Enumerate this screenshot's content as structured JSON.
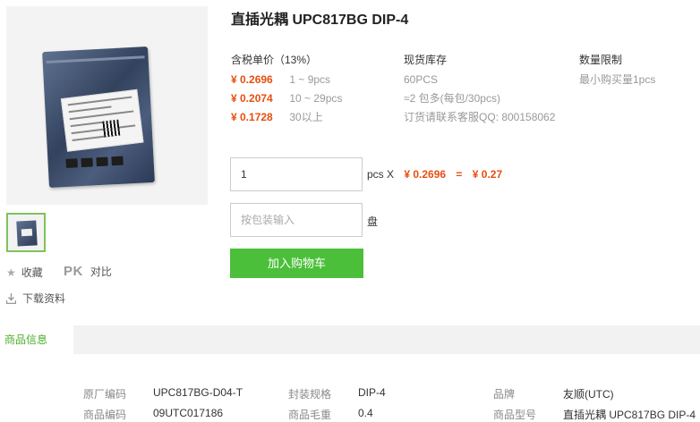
{
  "product": {
    "title": "直插光耦 UPC817BG DIP-4"
  },
  "pricing": {
    "header": "含税单价（13%）",
    "rows": [
      {
        "price": "¥ 0.2696",
        "range": "1 ~ 9pcs"
      },
      {
        "price": "¥ 0.2074",
        "range": "10 ~ 29pcs"
      },
      {
        "price": "¥ 0.1728",
        "range": "30以上"
      }
    ]
  },
  "stock": {
    "header": "现货库存",
    "qty": "60PCS",
    "pack": "≈2 包多(每包/30pcs)",
    "contact": "订货请联系客服QQ: 800158062"
  },
  "limit": {
    "header": "数量限制",
    "min": "最小购买量1pcs"
  },
  "order": {
    "qty_value": "1",
    "qty_unit": "pcs X",
    "unit_price": "¥ 0.2696",
    "equals": "=",
    "total": "¥ 0.27",
    "pack_placeholder": "按包装输入",
    "pack_unit": "盘",
    "cart_button": "加入购物车"
  },
  "actions": {
    "favorite": "收藏",
    "compare_badge": "PK",
    "compare": "对比",
    "download": "下载资料"
  },
  "tabs": {
    "active": "商品信息"
  },
  "specs": {
    "rows": [
      [
        {
          "k": "原厂编码",
          "v": "UPC817BG-D04-T"
        },
        {
          "k": "封装规格",
          "v": "DIP-4"
        },
        {
          "k": "品牌",
          "v": "友顺(UTC)"
        }
      ],
      [
        {
          "k": "商品编码",
          "v": "09UTC017186"
        },
        {
          "k": "商品毛重",
          "v": "0.4"
        },
        {
          "k": "商品型号",
          "v": "直插光耦 UPC817BG DIP-4"
        }
      ]
    ]
  },
  "colors": {
    "accent_orange": "#e84e0f",
    "button_green": "#4cbf3a",
    "tab_green": "#4cae2a"
  }
}
